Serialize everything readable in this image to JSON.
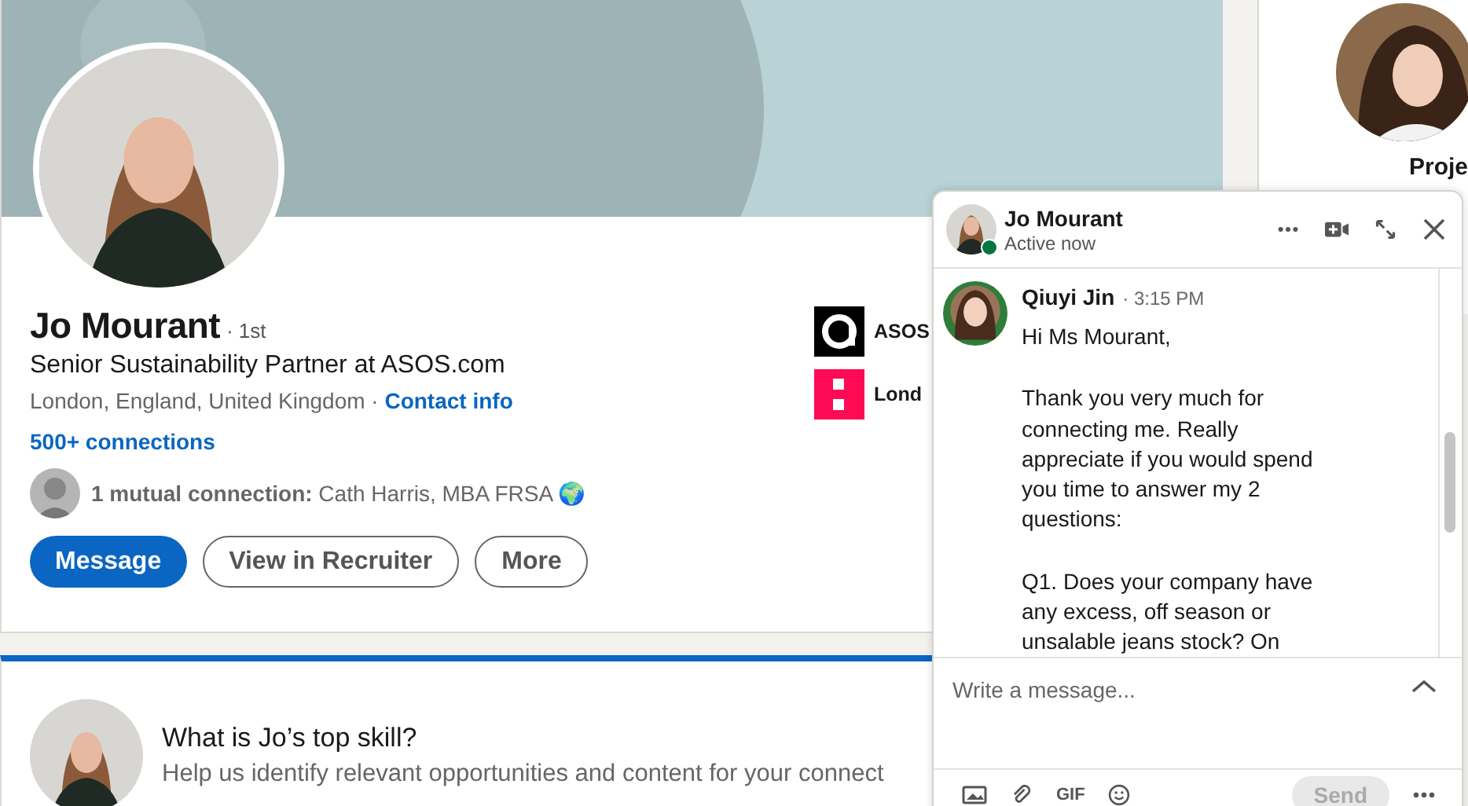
{
  "profile": {
    "name": "Jo Mourant",
    "degree": "· 1st",
    "headline": "Senior Sustainability Partner at ASOS.com",
    "location": "London, England, United Kingdom ·",
    "contact_link": "Contact info",
    "connections": "500+ connections",
    "mutual": "**1 mutual connection:** Cath Harris, MBA FRSA 🌍",
    "buttons": [
      {
        "label": "Message",
        "kind": "primary"
      },
      {
        "label": "View in Recruiter",
        "kind": "outline"
      },
      {
        "label": "More",
        "kind": "outline"
      }
    ],
    "companies": [
      {
        "name": "ASOS",
        "kind": "asos"
      },
      {
        "name": "Lond",
        "kind": "school"
      }
    ]
  },
  "skill_card": {
    "title": "What is Jo’s top skill?",
    "subtitle": "Help us identify relevant opportunities and content for your connect"
  },
  "sidebar": {
    "name": "Proje"
  },
  "chat": {
    "name": "Jo Mourant",
    "status": "Active now",
    "online": true,
    "message": {
      "sender": "Qiuyi Jin",
      "time": "· 3:15 PM",
      "paragraphs": [
        "Hi Ms Mourant,",
        "Thank you very much for connecting me. Really appreciate if you would spend you time to answer my 2 questions:",
        "Q1. Does your company have any excess, off season or unsalable jeans stock? On"
      ]
    },
    "compose": {
      "placeholder": "Write a message..."
    },
    "send": {
      "label": "Send",
      "disabled": true
    },
    "gif": "GIF"
  }
}
